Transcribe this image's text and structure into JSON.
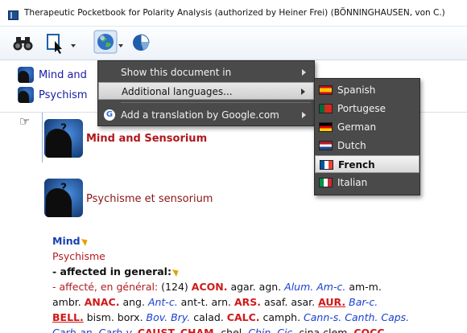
{
  "window": {
    "title": "Therapeutic Pocketbook for Polarity Analysis (authorized by Heiner Frei)  (BÖNNINGHAUSEN, von C.)"
  },
  "toolbar": {
    "buttons": [
      "binoculars-icon",
      "document-select-icon",
      "globe-icon",
      "pie-chart-icon"
    ]
  },
  "tree": {
    "items": [
      {
        "label": "Mind and"
      },
      {
        "label": "Psychism"
      }
    ]
  },
  "document": {
    "heading_en": "Mind and Sensorium",
    "heading_fr": "Psychisme et sensorium"
  },
  "rubric": {
    "mind": "Mind",
    "psychisme": "Psychisme",
    "sub_en": "- affected in general:",
    "sub_fr": "- affecté, en général:",
    "count": "(124)",
    "line3": [
      {
        "t": "ambr.",
        "g": "p1"
      },
      {
        "t": "ANAC.",
        "g": "b3"
      },
      {
        "t": "ang.",
        "g": "p1"
      },
      {
        "t": "Ant-c.",
        "g": "i2"
      },
      {
        "t": "ant-t.",
        "g": "p1"
      },
      {
        "t": "arn.",
        "g": "p1"
      },
      {
        "t": "ARS.",
        "g": "b3"
      },
      {
        "t": "asaf.",
        "g": "p1"
      },
      {
        "t": "asar.",
        "g": "p1"
      },
      {
        "t": "AUR.",
        "g": "b3u"
      },
      {
        "t": "Bar-c.",
        "g": "i2"
      }
    ],
    "line2": [
      {
        "t": "ACON.",
        "g": "b3"
      },
      {
        "t": "agar.",
        "g": "p1"
      },
      {
        "t": "agn.",
        "g": "p1"
      },
      {
        "t": "Alum.",
        "g": "i2"
      },
      {
        "t": "Am-c.",
        "g": "i2"
      },
      {
        "t": "am-m.",
        "g": "p1"
      }
    ],
    "line4": [
      {
        "t": "BELL.",
        "g": "b3u"
      },
      {
        "t": "bism.",
        "g": "p1"
      },
      {
        "t": "borx.",
        "g": "p1"
      },
      {
        "t": "Bov.",
        "g": "i2"
      },
      {
        "t": "Bry.",
        "g": "i2"
      },
      {
        "t": "calad.",
        "g": "p1"
      },
      {
        "t": "CALC.",
        "g": "b3"
      },
      {
        "t": "camph.",
        "g": "p1"
      },
      {
        "t": "Cann-s.",
        "g": "i2"
      },
      {
        "t": "Canth.",
        "g": "i2"
      },
      {
        "t": "Caps.",
        "g": "i2"
      }
    ],
    "line5": [
      {
        "t": "Carb-an.",
        "g": "i2"
      },
      {
        "t": "Carb-v.",
        "g": "i2"
      },
      {
        "t": "CAUST.",
        "g": "b3"
      },
      {
        "t": "CHAM.",
        "g": "b3"
      },
      {
        "t": "chel.",
        "g": "p1"
      },
      {
        "t": "Chin.",
        "g": "i2"
      },
      {
        "t": "Cic.",
        "g": "i2"
      },
      {
        "t": "cina",
        "g": "p1"
      },
      {
        "t": "clem.",
        "g": "p1"
      },
      {
        "t": "COCC.",
        "g": "b3"
      }
    ]
  },
  "menu": {
    "items": [
      {
        "label": "Show this document in",
        "submenu": true
      },
      {
        "label": "Additional languages...",
        "submenu": true,
        "selected": true
      },
      {
        "label": "Add a translation by Google.com",
        "submenu": true
      }
    ]
  },
  "languages": {
    "items": [
      {
        "label": "Spanish",
        "flag": "spain"
      },
      {
        "label": "Portugese",
        "flag": "portugal"
      },
      {
        "label": "German",
        "flag": "germany"
      },
      {
        "label": "Dutch",
        "flag": "netherlands"
      },
      {
        "label": "French",
        "flag": "france",
        "selected": true
      },
      {
        "label": "Italian",
        "flag": "italy"
      }
    ]
  },
  "colors": {
    "menu_bg": "#4a4a4a",
    "heading_red": "#b0181d",
    "remedy_bold": "#d01a1a",
    "remedy_italic": "#1a3fd0"
  }
}
